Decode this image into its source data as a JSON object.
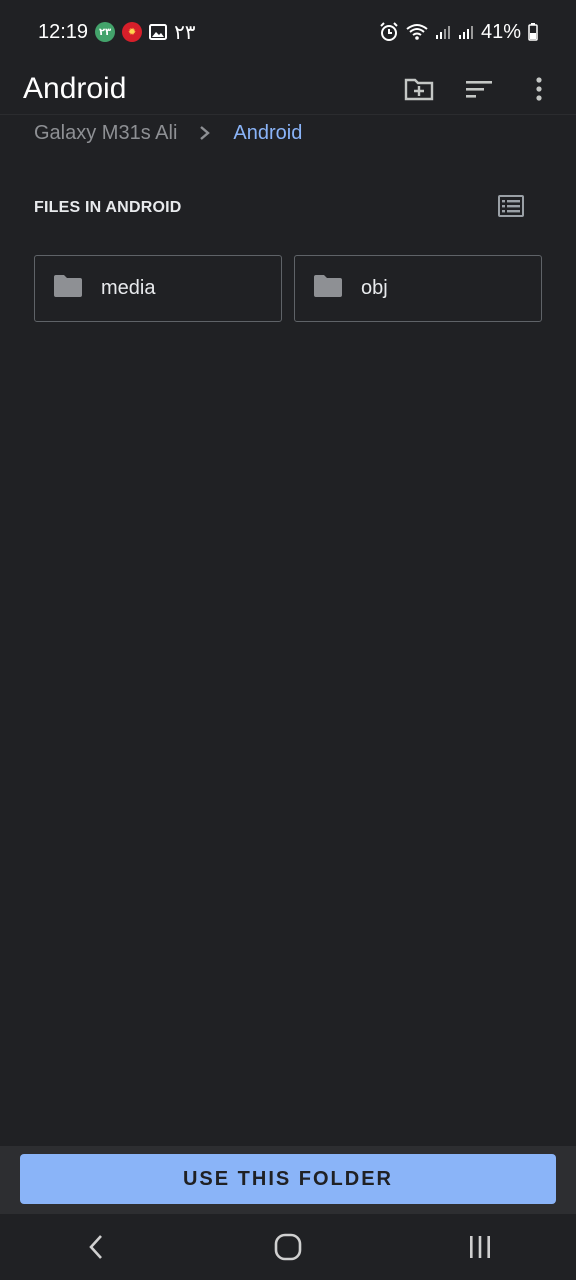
{
  "status_bar": {
    "time": "12:19",
    "notif_1": "۲۳",
    "notif_3": "۲۳",
    "battery": "41%"
  },
  "app_bar": {
    "title": "Android",
    "icons": [
      "create-folder-icon",
      "sort-icon",
      "more-vert-icon"
    ]
  },
  "breadcrumb": {
    "device": "Galaxy M31s Ali",
    "current": "Android"
  },
  "section": {
    "title": "FILES IN ANDROID",
    "view_icon": "list-view-icon"
  },
  "folders": [
    {
      "name": "media",
      "icon": "folder-icon"
    },
    {
      "name": "obj",
      "icon": "folder-icon"
    }
  ],
  "primary_action": {
    "label": "USE THIS FOLDER"
  },
  "colors": {
    "background": "#202124",
    "accent": "#8ab4f8",
    "text": "#e8eaed",
    "muted": "#8e9094"
  }
}
